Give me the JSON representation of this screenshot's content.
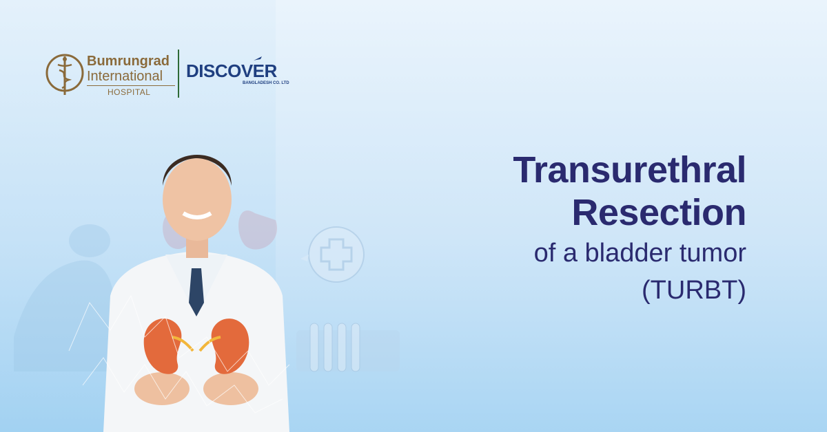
{
  "logos": {
    "hospital": {
      "line1": "Bumrungrad",
      "line2": "International",
      "line3": "HOSPITAL"
    },
    "partner": {
      "word": "DISCOVER",
      "sub": "BANGLADESH CO. LTD"
    }
  },
  "headline": {
    "line1": "Transurethral",
    "line2": "Resection",
    "line3": "of a bladder tumor",
    "line4": "(TURBT)"
  },
  "colors": {
    "headline": "#2a2a6f",
    "hospital_gold": "#8a6a3a",
    "partner_blue": "#1f3f80",
    "divider_green": "#2d6a36",
    "kidney": "#e36a3c"
  },
  "illustration": {
    "icons": [
      "medical-cross-icon",
      "kidney-icon",
      "test-tubes-icon",
      "doctor-illustration"
    ]
  }
}
